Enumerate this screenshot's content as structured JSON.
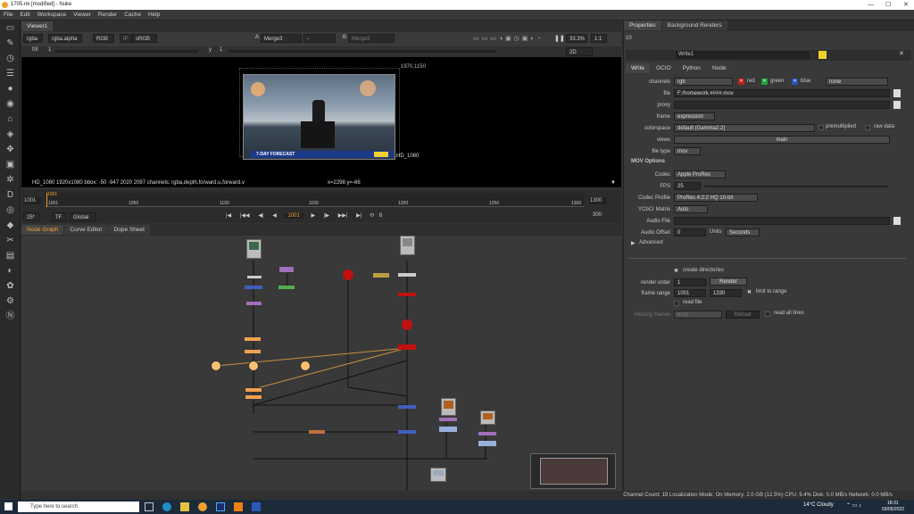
{
  "window": {
    "title": "1705.nk [modified] - Nuke"
  },
  "menu": [
    "File",
    "Edit",
    "Workspace",
    "Viewer",
    "Render",
    "Cache",
    "Help"
  ],
  "viewer": {
    "tab": "Viewer1",
    "channels": "rgba",
    "alpha": "rgba.alpha",
    "rgb": "RGB",
    "ip": "IP",
    "colorspace": "sRGB",
    "a_input": "Merge3",
    "a_dash": "-",
    "b_input": "Merge3",
    "a_label": "A",
    "b_label": "B",
    "zoom": "33.3%",
    "ratio": "1:1",
    "view_mode": "2D",
    "fstop": "f/8",
    "fstop_val": "1",
    "y_label": "y",
    "y_val": "1",
    "res_label": "1970,1150",
    "format_label": "HD_1080",
    "forecast_text": "7-DAY FORECAST",
    "status": "HD_1080 1920x1080  bbox: -50 -947 2020 2097 channels: rgba,depth,forward.u,forward.v",
    "coords": "x=2298 y=-66"
  },
  "timeline": {
    "start": "1001",
    "end": "1300",
    "ticks": [
      "1001",
      "1050",
      "1100",
      "1150",
      "1200",
      "1250",
      "1300"
    ],
    "marker": "1001",
    "fps": "25*",
    "tf": "TF",
    "global": "Global",
    "current_frame": "1001",
    "step": "8",
    "frame_range_end": "300"
  },
  "nodegraph": {
    "tabs": [
      "Node Graph",
      "Curve Editor",
      "Dope Sheet"
    ]
  },
  "status_bar": "Channel Count: 19  Localization Mode: On  Memory: 2.0 GB (12.5%)  CPU: 9.4%  Disk: 0.0 MB/s  Network: 0.0 MB/s",
  "properties": {
    "tabs": [
      "Properties",
      "Background Renders"
    ],
    "max_panels": "10",
    "node_name": "Write1",
    "sub_tabs": [
      "Write",
      "OCIO",
      "Python",
      "Node"
    ],
    "channels_label": "channels",
    "channels_val": "rgb",
    "red": "red",
    "green": "green",
    "blue": "blue",
    "none": "none",
    "file_label": "file",
    "file_val": "F:/homework.####.mov",
    "proxy_label": "proxy",
    "frame_label": "frame",
    "frame_val": "expression",
    "colorspace_label": "colorspace",
    "colorspace_val": "default (Gamma2.2)",
    "premultiplied": "premultiplied",
    "raw_data": "raw data",
    "views_label": "views",
    "views_val": "main",
    "file_type_label": "file type",
    "file_type_val": "mov",
    "mov_options": "MOV Options",
    "codec_label": "Codec",
    "codec_val": "Apple ProRes",
    "fps_label": "FPS",
    "fps_val": "25",
    "codec_profile_label": "Codec Profile",
    "codec_profile_val": "ProRes 4:2:2 HQ 10-bit",
    "ycbcr_label": "YCbCr Matrix",
    "ycbcr_val": "Auto",
    "audio_file_label": "Audio File",
    "audio_offset_label": "Audio Offset",
    "audio_offset_val": "0",
    "units_label": "Units",
    "units_val": "Seconds",
    "advanced": "Advanced",
    "create_directories": "create directories",
    "render_order_label": "render order",
    "render_order_val": "1",
    "render_button": "Render",
    "frame_range_label": "frame range",
    "frame_range_start": "1001",
    "frame_range_end": "1330",
    "limit_to_range": "limit to range",
    "read_file": "read file",
    "missing_frames_label": "missing frames",
    "missing_frames_val": "error",
    "reload_button": "Reload",
    "read_all_lines": "read all lines"
  },
  "taskbar": {
    "search_placeholder": "Type here to search",
    "weather": "14°C  Cloudy",
    "time": "18:31",
    "date": "03/05/2022"
  }
}
